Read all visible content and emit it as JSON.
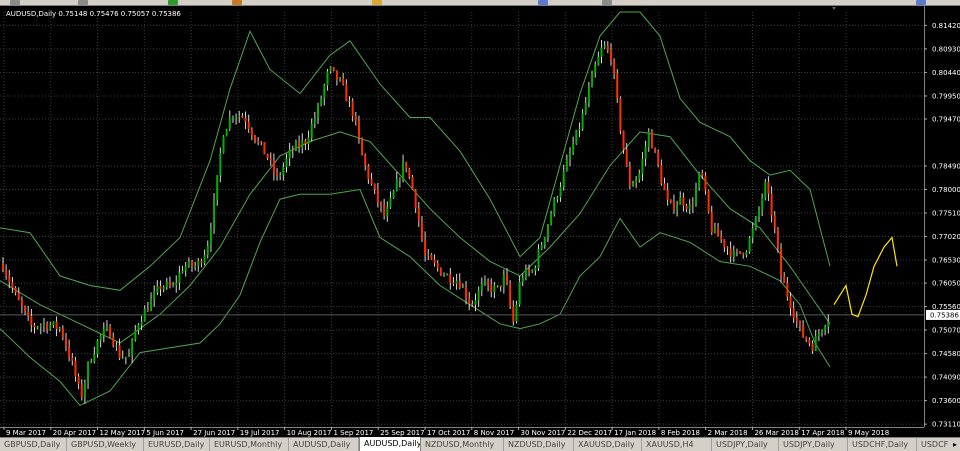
{
  "chart_data": {
    "type": "candlestick",
    "symbol_header": "AUDUSD,Daily  0.75148 0.75476 0.75057 0.75386",
    "ylim": [
      0.7305,
      0.817
    ],
    "y_ticks": [
      "0.81420",
      "0.80930",
      "0.80440",
      "0.79950",
      "0.79470",
      "0.78490",
      "0.78000",
      "0.77510",
      "0.77020",
      "0.76530",
      "0.76050",
      "0.75560",
      "0.75070",
      "0.74580",
      "0.74090",
      "0.73600",
      "0.73110"
    ],
    "current_price": "0.75386",
    "x_tick_labels": [
      "9 Mar 2017",
      "20 Apr 2017",
      "12 May 2017",
      "5 Jun 2017",
      "27 Jun 2017",
      "19 Jul 2017",
      "10 Aug 2017",
      "1 Sep 2017",
      "25 Sep 2017",
      "17 Oct 2017",
      "8 Nov 2017",
      "30 Nov 2017",
      "22 Dec 2017",
      "17 Jan 2018",
      "8 Feb 2018",
      "2 Mar 2018",
      "26 Mar 2018",
      "17 Apr 2018",
      "9 May 2018"
    ],
    "price_path": [
      [
        0,
        0.7655
      ],
      [
        14,
        0.758
      ],
      [
        30,
        0.7515
      ],
      [
        45,
        0.752
      ],
      [
        60,
        0.751
      ],
      [
        72,
        0.743
      ],
      [
        80,
        0.7365
      ],
      [
        88,
        0.744
      ],
      [
        98,
        0.749
      ],
      [
        108,
        0.751
      ],
      [
        118,
        0.7455
      ],
      [
        128,
        0.745
      ],
      [
        136,
        0.752
      ],
      [
        148,
        0.756
      ],
      [
        160,
        0.76
      ],
      [
        172,
        0.7595
      ],
      [
        182,
        0.764
      ],
      [
        196,
        0.764
      ],
      [
        206,
        0.768
      ],
      [
        214,
        0.778
      ],
      [
        222,
        0.792
      ],
      [
        232,
        0.796
      ],
      [
        244,
        0.795
      ],
      [
        256,
        0.79
      ],
      [
        266,
        0.787
      ],
      [
        276,
        0.782
      ],
      [
        290,
        0.788
      ],
      [
        304,
        0.79
      ],
      [
        316,
        0.796
      ],
      [
        328,
        0.805
      ],
      [
        340,
        0.802
      ],
      [
        352,
        0.796
      ],
      [
        362,
        0.786
      ],
      [
        372,
        0.78
      ],
      [
        384,
        0.774
      ],
      [
        394,
        0.78
      ],
      [
        404,
        0.786
      ],
      [
        414,
        0.778
      ],
      [
        424,
        0.766
      ],
      [
        434,
        0.764
      ],
      [
        446,
        0.762
      ],
      [
        458,
        0.761
      ],
      [
        470,
        0.756
      ],
      [
        482,
        0.76
      ],
      [
        496,
        0.759
      ],
      [
        504,
        0.762
      ],
      [
        512,
        0.752
      ],
      [
        520,
        0.762
      ],
      [
        532,
        0.763
      ],
      [
        544,
        0.771
      ],
      [
        556,
        0.779
      ],
      [
        570,
        0.788
      ],
      [
        580,
        0.794
      ],
      [
        592,
        0.804
      ],
      [
        602,
        0.81
      ],
      [
        610,
        0.808
      ],
      [
        620,
        0.792
      ],
      [
        628,
        0.781
      ],
      [
        638,
        0.783
      ],
      [
        648,
        0.792
      ],
      [
        658,
        0.784
      ],
      [
        668,
        0.776
      ],
      [
        680,
        0.778
      ],
      [
        690,
        0.776
      ],
      [
        700,
        0.784
      ],
      [
        710,
        0.772
      ],
      [
        722,
        0.769
      ],
      [
        734,
        0.766
      ],
      [
        746,
        0.768
      ],
      [
        756,
        0.774
      ],
      [
        764,
        0.781
      ],
      [
        772,
        0.774
      ],
      [
        780,
        0.762
      ],
      [
        790,
        0.756
      ],
      [
        800,
        0.75
      ],
      [
        812,
        0.7475
      ],
      [
        822,
        0.752
      ],
      [
        830,
        0.7538
      ]
    ],
    "bollinger": {
      "upper": [
        [
          0,
          0.772
        ],
        [
          30,
          0.771
        ],
        [
          60,
          0.762
        ],
        [
          90,
          0.76
        ],
        [
          120,
          0.759
        ],
        [
          150,
          0.764
        ],
        [
          180,
          0.77
        ],
        [
          210,
          0.786
        ],
        [
          230,
          0.801
        ],
        [
          250,
          0.813
        ],
        [
          270,
          0.805
        ],
        [
          300,
          0.8
        ],
        [
          330,
          0.808
        ],
        [
          350,
          0.811
        ],
        [
          380,
          0.802
        ],
        [
          410,
          0.795
        ],
        [
          430,
          0.795
        ],
        [
          460,
          0.788
        ],
        [
          490,
          0.778
        ],
        [
          520,
          0.766
        ],
        [
          540,
          0.77
        ],
        [
          560,
          0.785
        ],
        [
          580,
          0.8
        ],
        [
          600,
          0.812
        ],
        [
          620,
          0.817
        ],
        [
          640,
          0.817
        ],
        [
          660,
          0.812
        ],
        [
          680,
          0.799
        ],
        [
          700,
          0.794
        ],
        [
          730,
          0.791
        ],
        [
          750,
          0.786
        ],
        [
          770,
          0.783
        ],
        [
          790,
          0.784
        ],
        [
          810,
          0.78
        ],
        [
          830,
          0.764
        ]
      ],
      "middle": [
        [
          0,
          0.761
        ],
        [
          40,
          0.756
        ],
        [
          80,
          0.752
        ],
        [
          120,
          0.748
        ],
        [
          160,
          0.754
        ],
        [
          190,
          0.76
        ],
        [
          220,
          0.768
        ],
        [
          250,
          0.779
        ],
        [
          280,
          0.787
        ],
        [
          310,
          0.79
        ],
        [
          340,
          0.792
        ],
        [
          370,
          0.79
        ],
        [
          400,
          0.783
        ],
        [
          430,
          0.776
        ],
        [
          460,
          0.77
        ],
        [
          490,
          0.765
        ],
        [
          520,
          0.762
        ],
        [
          550,
          0.768
        ],
        [
          580,
          0.775
        ],
        [
          610,
          0.785
        ],
        [
          640,
          0.792
        ],
        [
          670,
          0.791
        ],
        [
          700,
          0.783
        ],
        [
          730,
          0.776
        ],
        [
          760,
          0.772
        ],
        [
          790,
          0.764
        ],
        [
          810,
          0.758
        ],
        [
          830,
          0.752
        ]
      ],
      "lower": [
        [
          0,
          0.751
        ],
        [
          30,
          0.745
        ],
        [
          60,
          0.74
        ],
        [
          80,
          0.735
        ],
        [
          110,
          0.738
        ],
        [
          140,
          0.746
        ],
        [
          170,
          0.747
        ],
        [
          200,
          0.748
        ],
        [
          220,
          0.752
        ],
        [
          240,
          0.758
        ],
        [
          260,
          0.769
        ],
        [
          280,
          0.778
        ],
        [
          300,
          0.779
        ],
        [
          330,
          0.779
        ],
        [
          360,
          0.78
        ],
        [
          380,
          0.77
        ],
        [
          410,
          0.766
        ],
        [
          440,
          0.76
        ],
        [
          470,
          0.756
        ],
        [
          500,
          0.752
        ],
        [
          520,
          0.751
        ],
        [
          540,
          0.752
        ],
        [
          560,
          0.754
        ],
        [
          580,
          0.762
        ],
        [
          600,
          0.766
        ],
        [
          620,
          0.774
        ],
        [
          640,
          0.768
        ],
        [
          660,
          0.771
        ],
        [
          690,
          0.769
        ],
        [
          720,
          0.765
        ],
        [
          750,
          0.764
        ],
        [
          780,
          0.761
        ],
        [
          800,
          0.756
        ],
        [
          815,
          0.748
        ],
        [
          830,
          0.743
        ]
      ]
    },
    "projection": [
      [
        834,
        0.756
      ],
      [
        840,
        0.758
      ],
      [
        846,
        0.76
      ],
      [
        852,
        0.754
      ],
      [
        858,
        0.7535
      ],
      [
        866,
        0.758
      ],
      [
        874,
        0.764
      ],
      [
        884,
        0.768
      ],
      [
        892,
        0.77
      ],
      [
        897,
        0.764
      ]
    ],
    "colors": {
      "bull": "#00b000",
      "bear": "#ff3000",
      "wick": "#d8d8d8",
      "band": "#4ea84e",
      "projection": "#ffe600",
      "grid": "#3c3c3c",
      "text": "#ffffff",
      "price_line": "#5a5a5a"
    }
  },
  "tabs": [
    {
      "label": "GBPUSD,Daily",
      "active": false
    },
    {
      "label": "GBPUSD,Weekly",
      "active": false
    },
    {
      "label": "EURUSD,Daily",
      "active": false
    },
    {
      "label": "EURUSD,Monthly",
      "active": false
    },
    {
      "label": "AUDUSD,Daily",
      "active": false
    },
    {
      "label": "AUDUSD,Daily",
      "active": true
    },
    {
      "label": "NZDUSD,Monthly",
      "active": false
    },
    {
      "label": "NZDUSD,Daily",
      "active": false
    },
    {
      "label": "XAUUSD,Daily",
      "active": false
    },
    {
      "label": "XAUUSD,H4",
      "active": false
    },
    {
      "label": "USDJPY,Daily",
      "active": false
    },
    {
      "label": "USDJPY,Daily",
      "active": false
    },
    {
      "label": "USDCHF,Daily",
      "active": false
    },
    {
      "label": "USDCF",
      "active": false
    }
  ],
  "tab_scroll_glyph": "▸"
}
